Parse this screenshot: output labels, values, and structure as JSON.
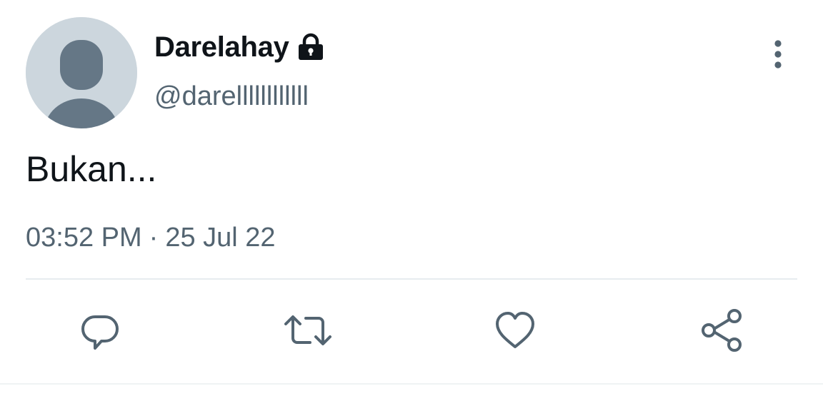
{
  "user": {
    "display_name": "Darelahay",
    "handle": "@darellllllllllll",
    "protected": true,
    "avatar": "default-avatar"
  },
  "tweet": {
    "text": "Bukan...",
    "time": "03:52 PM",
    "separator": "·",
    "date": "25 Jul 22"
  },
  "actions": [
    {
      "icon": "reply-icon"
    },
    {
      "icon": "retweet-icon"
    },
    {
      "icon": "like-icon"
    },
    {
      "icon": "share-icon"
    }
  ],
  "icons": {
    "lock": "lock-icon",
    "more": "more-vertical-icon"
  },
  "colors": {
    "text_primary": "#0f1419",
    "text_secondary": "#536471",
    "avatar_bg": "#ccd6dd",
    "avatar_figure": "#657786",
    "divider": "#e7ecef"
  }
}
